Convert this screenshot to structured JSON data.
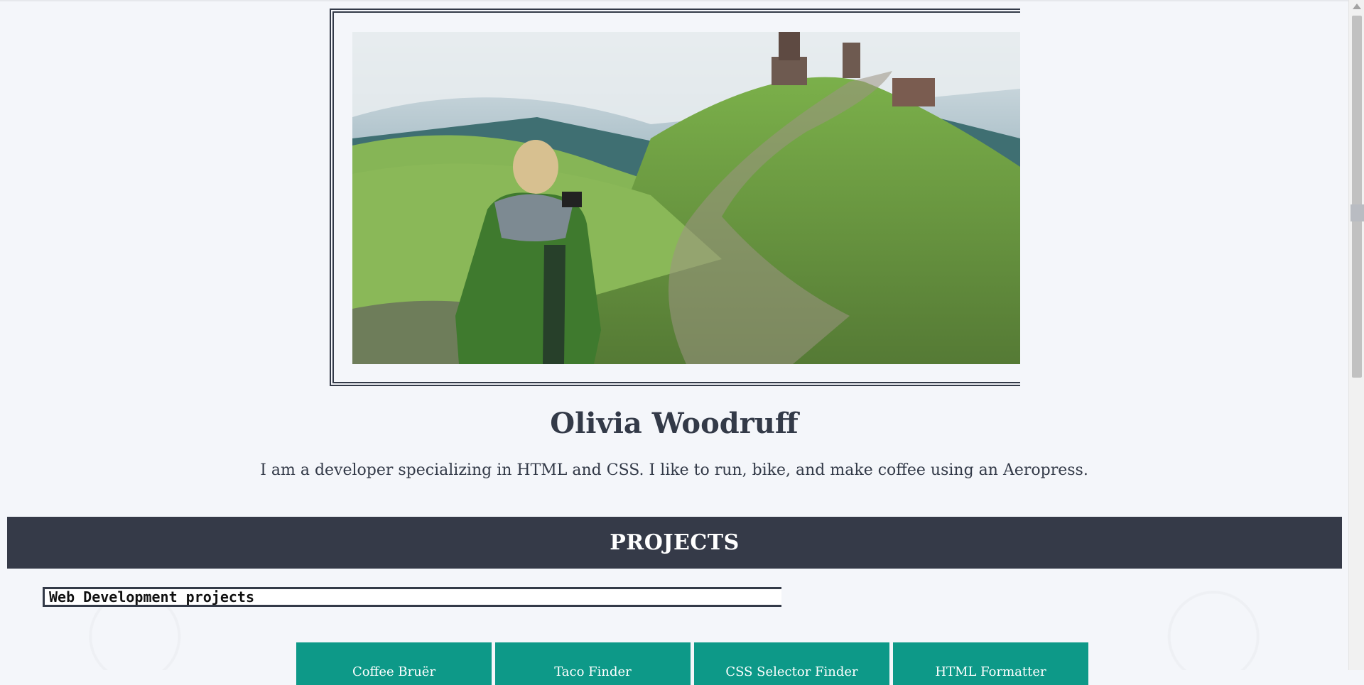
{
  "profile": {
    "name": "Olivia Woodruff",
    "bio": "I am a developer specializing in HTML and CSS. I like to run, bike, and make coffee using an Aeropress."
  },
  "projects_section": {
    "heading": "PROJECTS",
    "subheading": "Web Development projects",
    "items": [
      {
        "label": "Coffee Bruër"
      },
      {
        "label": "Taco Finder"
      },
      {
        "label": "CSS Selector Finder"
      },
      {
        "label": "HTML Formatter"
      }
    ]
  },
  "colors": {
    "background": "#f4f6fa",
    "banner": "#353a48",
    "project_button": "#0d9988",
    "text": "#333a48"
  }
}
